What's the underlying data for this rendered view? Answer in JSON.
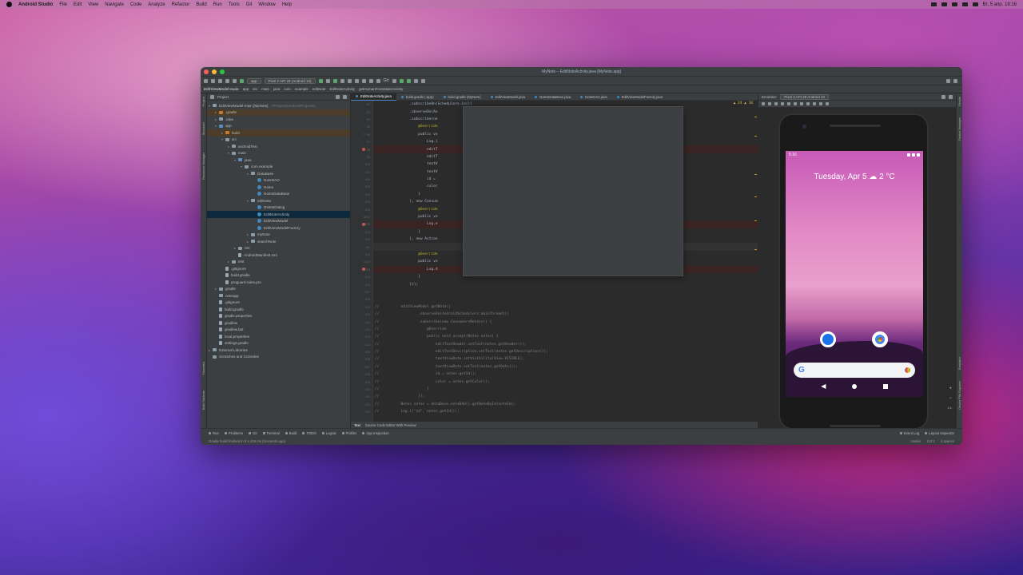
{
  "menubar": {
    "items": [
      "Android Studio",
      "File",
      "Edit",
      "View",
      "Navigate",
      "Code",
      "Analyze",
      "Refactor",
      "Build",
      "Run",
      "Tools",
      "Git",
      "Window",
      "Help"
    ],
    "clock": "Вт, 5 апр.  18:16"
  },
  "window": {
    "title": "MyNote – EditNoteActivity.java [MyNote.app]"
  },
  "toolbar": {
    "run_config": "app",
    "device": "Pixel 2 API 29 (Android 10)",
    "git_label": "Git:"
  },
  "breadcrumbs": [
    "EditViewModel-main",
    "app",
    "src",
    "main",
    "java",
    "com",
    "example",
    "editNote",
    "EditNoteActivity",
    "getHumanFromMainActivity"
  ],
  "project": {
    "header": "Project",
    "tree": [
      {
        "label": "EditViewModel-main [MyNote]",
        "hint": "~/Projects/AndroidProjects/...",
        "depth": 0,
        "icon": "folder",
        "caret": "▾"
      },
      {
        "label": ".gradle",
        "depth": 1,
        "icon": "folder orange",
        "caret": "▸",
        "state": "hl"
      },
      {
        "label": ".idea",
        "depth": 1,
        "icon": "folder",
        "caret": "▸"
      },
      {
        "label": "app",
        "depth": 1,
        "icon": "folder blue",
        "caret": "▾"
      },
      {
        "label": "build",
        "depth": 2,
        "icon": "folder orange",
        "caret": "▸",
        "state": "hl"
      },
      {
        "label": "src",
        "depth": 2,
        "icon": "folder",
        "caret": "▾"
      },
      {
        "label": "androidTest",
        "depth": 3,
        "icon": "folder",
        "caret": "▸"
      },
      {
        "label": "main",
        "depth": 3,
        "icon": "folder",
        "caret": "▾"
      },
      {
        "label": "java",
        "depth": 4,
        "icon": "folder blue",
        "caret": "▾"
      },
      {
        "label": "com.example",
        "depth": 5,
        "icon": "folder",
        "caret": "▾"
      },
      {
        "label": "DataBase",
        "depth": 6,
        "icon": "folder",
        "caret": "▾"
      },
      {
        "label": "NoteDAO",
        "depth": 7,
        "icon": "cls",
        "caret": ""
      },
      {
        "label": "Notes",
        "depth": 7,
        "icon": "cls",
        "caret": ""
      },
      {
        "label": "NotesDataBase",
        "depth": 7,
        "icon": "cls",
        "caret": ""
      },
      {
        "label": "editNote",
        "depth": 6,
        "icon": "folder",
        "caret": "▾"
      },
      {
        "label": "DeleteDialog",
        "depth": 7,
        "icon": "cls",
        "caret": ""
      },
      {
        "label": "EditNoteActivity",
        "depth": 7,
        "icon": "cls",
        "caret": "",
        "state": "sel"
      },
      {
        "label": "EditViewModel",
        "depth": 7,
        "icon": "cls",
        "caret": ""
      },
      {
        "label": "EditViewModelFactory",
        "depth": 7,
        "icon": "cls",
        "caret": ""
      },
      {
        "label": "myNote",
        "depth": 6,
        "icon": "folder",
        "caret": "▸"
      },
      {
        "label": "searchNote",
        "depth": 6,
        "icon": "folder",
        "caret": "▸"
      },
      {
        "label": "res",
        "depth": 4,
        "icon": "folder",
        "caret": "▸"
      },
      {
        "label": "AndroidManifest.xml",
        "depth": 4,
        "icon": "file",
        "caret": ""
      },
      {
        "label": "test",
        "depth": 3,
        "icon": "folder",
        "caret": "▸"
      },
      {
        "label": ".gitignore",
        "depth": 2,
        "icon": "file",
        "caret": ""
      },
      {
        "label": "build.gradle",
        "depth": 2,
        "icon": "file",
        "caret": ""
      },
      {
        "label": "proguard-rules.pro",
        "depth": 2,
        "icon": "file",
        "caret": ""
      },
      {
        "label": "gradle",
        "depth": 1,
        "icon": "folder",
        "caret": "▸"
      },
      {
        "label": "noteapp",
        "depth": 1,
        "icon": "folder",
        "caret": ""
      },
      {
        "label": ".gitignore",
        "depth": 1,
        "icon": "file",
        "caret": ""
      },
      {
        "label": "build.gradle",
        "depth": 1,
        "icon": "file",
        "caret": ""
      },
      {
        "label": "gradle.properties",
        "depth": 1,
        "icon": "file",
        "caret": ""
      },
      {
        "label": "gradlew",
        "depth": 1,
        "icon": "file",
        "caret": ""
      },
      {
        "label": "gradlew.bat",
        "depth": 1,
        "icon": "file",
        "caret": ""
      },
      {
        "label": "local.properties",
        "depth": 1,
        "icon": "file",
        "caret": ""
      },
      {
        "label": "settings.gradle",
        "depth": 1,
        "icon": "file",
        "caret": ""
      },
      {
        "label": "External Libraries",
        "depth": 0,
        "icon": "folder",
        "caret": "▸"
      },
      {
        "label": "Scratches and Consoles",
        "depth": 0,
        "icon": "folder",
        "caret": ""
      }
    ]
  },
  "editor": {
    "tabs": [
      "EditNoteActivity.java",
      "build.gradle (:app)",
      "build.gradle (MyNote)",
      "EditViewModel.java",
      "NotesDataBase.java",
      "NoteDAO.java",
      "EditViewModelFactory.java"
    ],
    "active_tab": 0,
    "warnings": "▲ 24   ▲ 10",
    "lines": [
      {
        "n": "92",
        "text": "                .subscribeOn(Schedulers.io())",
        "cls": ""
      },
      {
        "n": "93",
        "text": "                .observeOn(An",
        "cls": ""
      },
      {
        "n": "94",
        "text": "                .subscribe(ne",
        "cls": ""
      },
      {
        "n": "95",
        "text": "                    @Override",
        "cls": "",
        "ann": true
      },
      {
        "n": "96",
        "text": "                    public vo",
        "cls": "",
        "mark": "ov"
      },
      {
        "n": "97",
        "text": "                        Log.i",
        "cls": ""
      },
      {
        "n": "98",
        "text": "                        editT",
        "cls": "bpl",
        "mark": "bp"
      },
      {
        "n": "99",
        "text": "                        editT",
        "cls": ""
      },
      {
        "n": "100",
        "text": "                        textV",
        "cls": ""
      },
      {
        "n": "101",
        "text": "                        textV",
        "cls": ""
      },
      {
        "n": "102",
        "text": "                        id = ",
        "cls": ""
      },
      {
        "n": "103",
        "text": "                        color",
        "cls": ""
      },
      {
        "n": "104",
        "text": "                    }",
        "cls": ""
      },
      {
        "n": "105",
        "text": "                }, new Consum",
        "cls": ""
      },
      {
        "n": "106",
        "text": "                    @Override",
        "cls": "",
        "ann": true
      },
      {
        "n": "107",
        "text": "                    public vo",
        "cls": "",
        "mark": "ov"
      },
      {
        "n": "108",
        "text": "                        Log.e",
        "cls": "bpl",
        "mark": "bp"
      },
      {
        "n": "109",
        "text": "                    }",
        "cls": ""
      },
      {
        "n": "110",
        "text": "                }, new Action",
        "cls": ""
      },
      {
        "n": "111",
        "text": "",
        "cls": "cur"
      },
      {
        "n": "112",
        "text": "                    @Override",
        "cls": "",
        "ann": true
      },
      {
        "n": "113",
        "text": "                    public vo",
        "cls": "",
        "mark": "ov"
      },
      {
        "n": "114",
        "text": "                        Log.d",
        "cls": "bpl",
        "mark": "bp"
      },
      {
        "n": "115",
        "text": "                    }",
        "cls": ""
      },
      {
        "n": "116",
        "text": "                }));",
        "cls": ""
      },
      {
        "n": "117",
        "text": "",
        "cls": ""
      },
      {
        "n": "118",
        "text": "",
        "cls": ""
      },
      {
        "n": "119",
        "text": "//          editViewModel.getNote()",
        "cls": "cm"
      },
      {
        "n": "120",
        "text": "//                  .observeOn(AndroidSchedulers.mainThread())",
        "cls": "cm"
      },
      {
        "n": "121",
        "text": "//                  .subscribe(new Consumer<Notes>() {",
        "cls": "cm"
      },
      {
        "n": "122",
        "text": "//                      @Override",
        "cls": "cm"
      },
      {
        "n": "123",
        "text": "//                      public void accept(Notes notes) {",
        "cls": "cm"
      },
      {
        "n": "124",
        "text": "//                          editTextHeader.setText(notes.getHeader());",
        "cls": "cm"
      },
      {
        "n": "125",
        "text": "//                          editTextDescription.setText(notes.getDescription());",
        "cls": "cm"
      },
      {
        "n": "126",
        "text": "//                          textViewDate.setVisibility(View.VISIBLE);",
        "cls": "cm"
      },
      {
        "n": "127",
        "text": "//                          textViewDate.setText(notes.getDate());",
        "cls": "cm"
      },
      {
        "n": "128",
        "text": "//                          id = notes.getId();",
        "cls": "cm"
      },
      {
        "n": "129",
        "text": "//                          color = notes.getColor();",
        "cls": "cm"
      },
      {
        "n": "130",
        "text": "//                      }",
        "cls": "cm"
      },
      {
        "n": "131",
        "text": "//                  });",
        "cls": "cm"
      },
      {
        "n": "132",
        "text": "//          Notes notes = dataBase.noteDAO().getNoteById(noteId);",
        "cls": "cm"
      },
      {
        "n": "133",
        "text": "//          Log.i(\"id\", notes.getId());",
        "cls": "cm"
      }
    ],
    "bottom_tabs": [
      "Text",
      "Source Code Editor With Preview"
    ]
  },
  "emulator": {
    "label": "Emulator:",
    "device_tab": "Pixel 2 API 29 Android 10",
    "time": "6:16",
    "glance": "Tuesday, Apr 5  ☁ 2 °C",
    "search_g": "G",
    "zoom_plus": "+",
    "zoom_minus": "−",
    "zoom_level": "1:1"
  },
  "left_tools": [
    "Project",
    "Structure",
    "Resource Manager",
    "Favorites",
    "Build Variants"
  ],
  "right_tools": [
    "Gradle",
    "Device Manager",
    "Emulator",
    "Device File Explorer"
  ],
  "tool_windows": [
    "Run",
    "Problems",
    "Git",
    "Terminal",
    "Build",
    "TODO",
    "Logcat",
    "Profiler",
    "App Inspection"
  ],
  "tool_windows_right": [
    "Event Log",
    "Layout Inspector"
  ],
  "status": {
    "message": "Gradle build finished in 9 s 429 ms (moments ago)",
    "position": "110:1",
    "indent": "4 spaces",
    "branch": "master"
  }
}
